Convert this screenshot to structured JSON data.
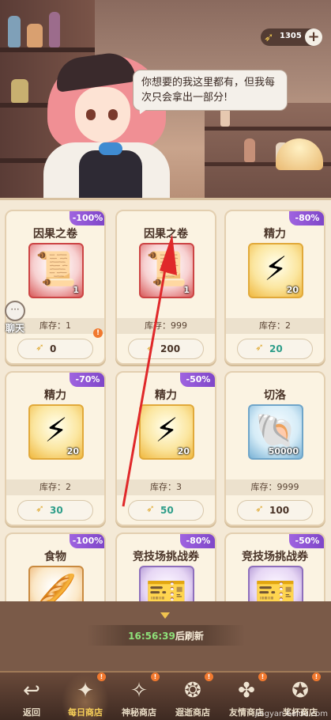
{
  "header": {
    "speech": "你想要的我这里都有，但我每次只会拿出一部分!",
    "currency_value": "1305",
    "currency_plus": "+"
  },
  "chat": {
    "label": "聊天"
  },
  "items": [
    {
      "discount": "-100%",
      "name": "因果之卷",
      "qty": "1",
      "stock": "库存：1",
      "price": "0",
      "icon": "scroll-icon",
      "color": "red",
      "alert": "!"
    },
    {
      "discount": "",
      "name": "因果之卷",
      "qty": "1",
      "stock": "库存：999",
      "price": "200",
      "icon": "scroll-icon",
      "color": "red"
    },
    {
      "discount": "-80%",
      "name": "精力",
      "qty": "20",
      "stock": "库存：2",
      "price": "20",
      "icon": "lightning-icon",
      "color": "gold",
      "teal": true
    },
    {
      "discount": "-70%",
      "name": "精力",
      "qty": "20",
      "stock": "库存：2",
      "price": "30",
      "icon": "lightning-icon",
      "color": "gold",
      "teal": true
    },
    {
      "discount": "-50%",
      "name": "精力",
      "qty": "20",
      "stock": "库存：3",
      "price": "50",
      "icon": "lightning-icon",
      "color": "gold",
      "teal": true
    },
    {
      "discount": "",
      "name": "切洛",
      "qty": "50000",
      "stock": "库存：9999",
      "price": "100",
      "icon": "shell-icon",
      "color": "blue"
    },
    {
      "discount": "-100%",
      "name": "食物",
      "icon": "food-icon",
      "color": "orange"
    },
    {
      "discount": "-80%",
      "name": "竞技场挑战券",
      "icon": "ticket-icon",
      "color": "purple"
    },
    {
      "discount": "-50%",
      "name": "竞技场挑战券",
      "icon": "ticket-icon",
      "color": "purple"
    }
  ],
  "refresh": {
    "countdown": "16:56:39",
    "suffix": "后刷新"
  },
  "nav": [
    {
      "label": "返回",
      "icon": "back-arrow-icon"
    },
    {
      "label": "每日商店",
      "icon": "daily-shop-icon",
      "active": true,
      "dot": "!"
    },
    {
      "label": "神秘商店",
      "icon": "mystery-shop-icon",
      "dot": "!"
    },
    {
      "label": "遐逝商店",
      "icon": "wander-shop-icon",
      "dot": "!"
    },
    {
      "label": "友情商店",
      "icon": "friendship-shop-icon",
      "dot": "!"
    },
    {
      "label": "奖杯商店",
      "icon": "trophy-shop-icon",
      "dot": "!"
    }
  ],
  "watermark": "jingyan.baidu.com",
  "colors": {
    "discount": "#8a55d6",
    "accent_gold": "#f0c34f",
    "annotation_arrow": "#e0282a"
  }
}
